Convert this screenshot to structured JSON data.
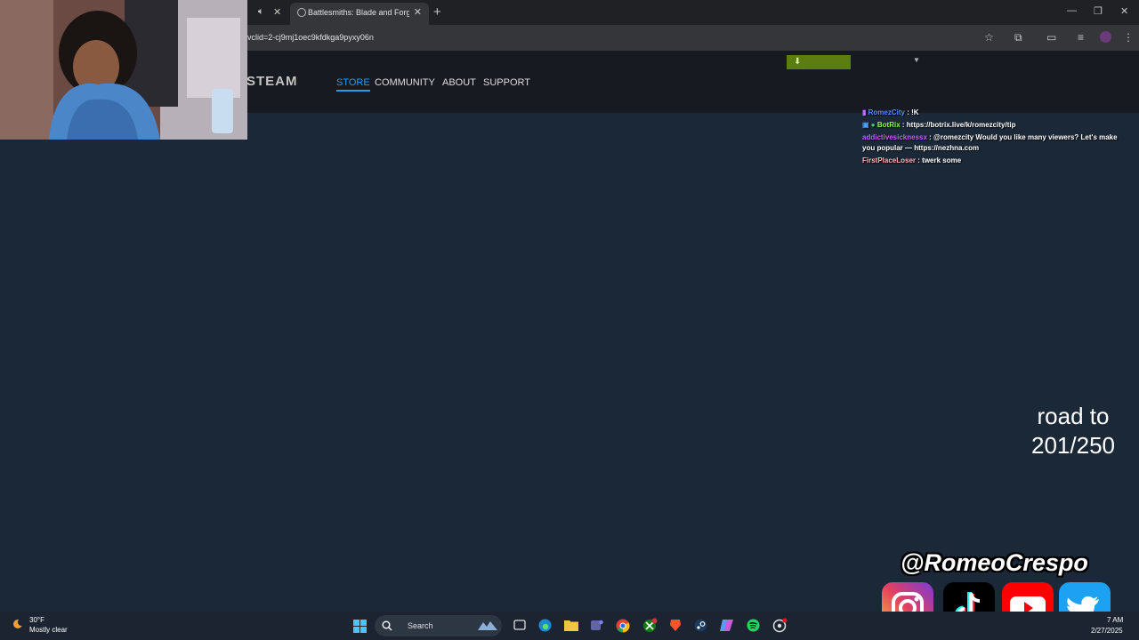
{
  "browser": {
    "tab_title": "Battlesmiths: Blade and Forge on Steam",
    "url": "vclid=2-cj9mj1oec9kfdkga9pyxy06n"
  },
  "steam": {
    "logo": "STEAM",
    "nav": [
      "STORE",
      "COMMUNITY",
      "ABOUT",
      "SUPPORT"
    ],
    "active_nav": "STORE"
  },
  "chat": [
    {
      "user": "RomezCity",
      "message": ": !K",
      "color": "#5b8cff"
    },
    {
      "user": "BotRix",
      "message": ": https://botrix.live/k/romezcity/tip",
      "color": "#8fff4a"
    },
    {
      "user": "addictivesicknessx",
      "message": ": @romezcity Would you like many viewers? Let's make you popular — https://nezhna.com",
      "color": "#c561ff"
    },
    {
      "user": "FirstPlaceLoser",
      "message": ": twerk some",
      "color": "#ffb3b3"
    }
  ],
  "overlay": {
    "goal_line1": "road to",
    "goal_line2": "201/250",
    "handle": "@RomeoCrespo"
  },
  "socials": [
    "instagram-icon",
    "tiktok-icon",
    "youtube-icon",
    "twitter-icon"
  ],
  "taskbar": {
    "weather_temp": "30°F",
    "weather_desc": "Mostly clear",
    "search_label": "Search",
    "time": "7 AM",
    "date": "2/27/2025"
  }
}
